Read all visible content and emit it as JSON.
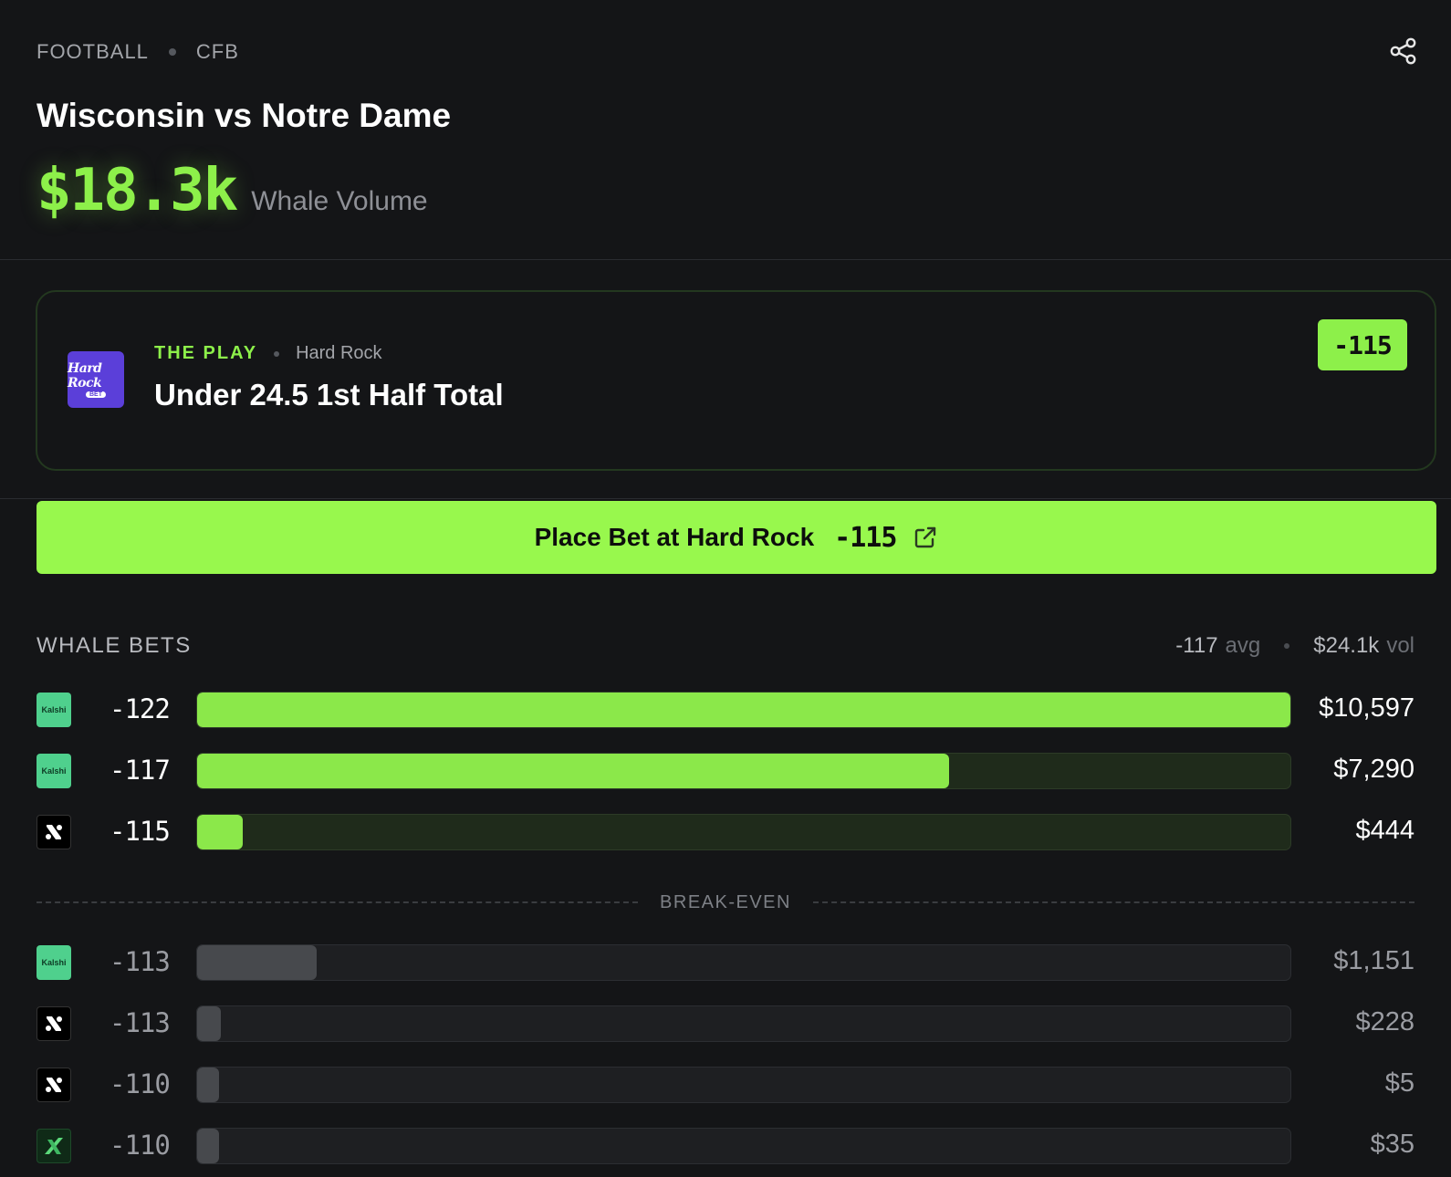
{
  "header": {
    "breadcrumb": [
      "FOOTBALL",
      "CFB"
    ],
    "title": "Wisconsin vs Notre Dame",
    "volume_value": "$18.3k",
    "volume_label": "Whale Volume"
  },
  "play": {
    "label": "THE PLAY",
    "book": "Hard Rock",
    "logo_text": "Hard Rock",
    "logo_subtext": "BET",
    "title": "Under 24.5 1st Half Total",
    "odds": "-115"
  },
  "place_bet": {
    "label": "Place Bet at Hard Rock",
    "odds": "-115"
  },
  "whale_bets": {
    "title": "WHALE BETS",
    "avg_value": "-117",
    "avg_unit": "avg",
    "vol_value": "$24.1k",
    "vol_unit": "vol",
    "breakeven_label": "BREAK-EVEN",
    "above": [
      {
        "book": "Kalshi",
        "odds": "-122",
        "amount": "$10,597",
        "fill": 1.0
      },
      {
        "book": "Kalshi",
        "odds": "-117",
        "amount": "$7,290",
        "fill": 0.688
      },
      {
        "book": "Novig",
        "odds": "-115",
        "amount": "$444",
        "fill": 0.042
      }
    ],
    "below": [
      {
        "book": "Kalshi",
        "odds": "-113",
        "amount": "$1,151",
        "fill": 0.109
      },
      {
        "book": "Novig",
        "odds": "-113",
        "amount": "$228",
        "fill": 0.022
      },
      {
        "book": "Novig",
        "odds": "-110",
        "amount": "$5",
        "fill": 0.02
      },
      {
        "book": "ProphetX",
        "odds": "-110",
        "amount": "$35",
        "fill": 0.02
      }
    ]
  },
  "colors": {
    "accent": "#8df04a",
    "background": "#141517",
    "bar_dim": "#47494d"
  },
  "icons": {
    "share": "share-icon",
    "external": "external-link-icon"
  }
}
